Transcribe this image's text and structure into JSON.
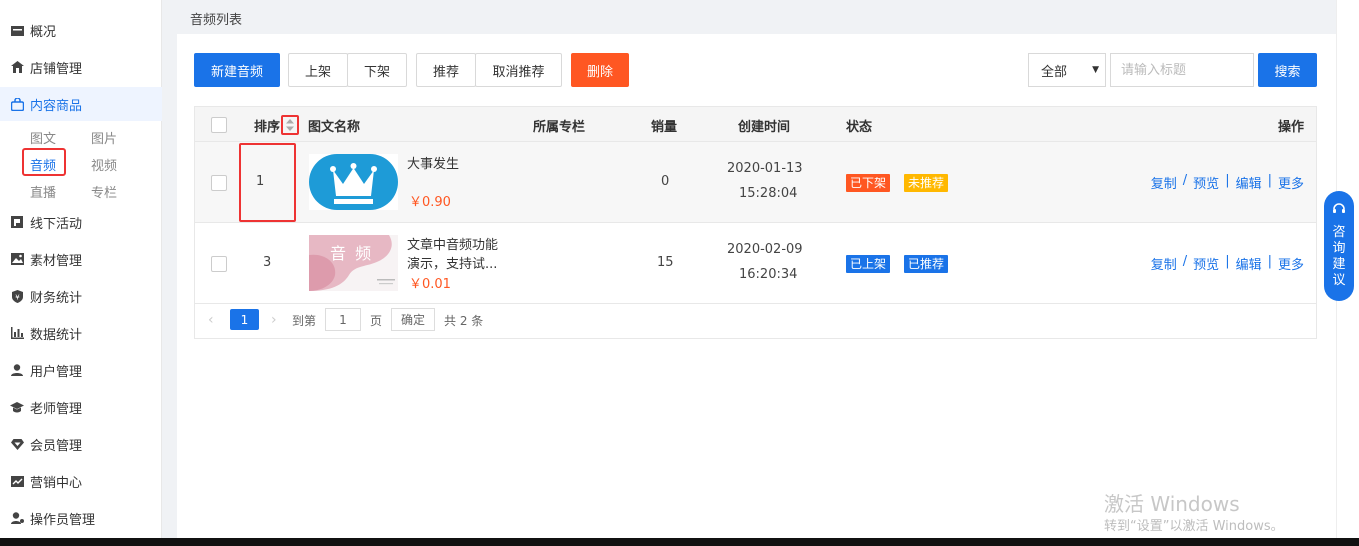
{
  "sidebar": {
    "items": [
      {
        "label": "概况",
        "icon": "folder-icon"
      },
      {
        "label": "店铺管理",
        "icon": "home-icon"
      },
      {
        "label": "内容商品",
        "icon": "bag-icon"
      },
      {
        "label": "线下活动",
        "icon": "flag-icon"
      },
      {
        "label": "素材管理",
        "icon": "image-icon"
      },
      {
        "label": "财务统计",
        "icon": "shield-icon"
      },
      {
        "label": "数据统计",
        "icon": "bar-chart-icon"
      },
      {
        "label": "用户管理",
        "icon": "user-icon"
      },
      {
        "label": "老师管理",
        "icon": "graduation-cap-icon"
      },
      {
        "label": "会员管理",
        "icon": "diamond-icon"
      },
      {
        "label": "营销中心",
        "icon": "trend-icon"
      },
      {
        "label": "操作员管理",
        "icon": "operator-icon"
      }
    ],
    "sub_items": [
      "图文",
      "图片",
      "音频",
      "视频",
      "直播",
      "专栏"
    ]
  },
  "breadcrumb": "音频列表",
  "toolbar": {
    "new_label": "新建音频",
    "shelve_label": "上架",
    "unshelve_label": "下架",
    "recommend_label": "推荐",
    "unrecommend_label": "取消推荐",
    "delete_label": "删除",
    "filter_value": "全部",
    "search_placeholder": "请输入标题",
    "search_label": "搜索"
  },
  "table": {
    "headers": {
      "sort": "排序",
      "name": "图文名称",
      "column": "所属专栏",
      "sales": "销量",
      "created": "创建时间",
      "status": "状态",
      "actions": "操作"
    },
    "rows": [
      {
        "sort": "1",
        "title": "大事发生",
        "price": "￥0.90",
        "sales": "0",
        "date": "2020-01-13",
        "time": "15:28:04",
        "status1": "已下架",
        "status2": "未推荐"
      },
      {
        "sort": "3",
        "title": "文章中音频功能演示，支持试...",
        "price": "￥0.01",
        "sales": "15",
        "date": "2020-02-09",
        "time": "16:20:34",
        "status1": "已上架",
        "status2": "已推荐",
        "thumb_text": "音 频"
      }
    ],
    "actions": {
      "copy": "复制",
      "preview": "预览",
      "edit": "编辑",
      "more": "更多"
    }
  },
  "pager": {
    "current": "1",
    "goto": "到第",
    "page_input": "1",
    "page_unit": "页",
    "confirm": "确定",
    "total": "共 2 条"
  },
  "consult": [
    "咨",
    "询",
    "建",
    "议"
  ],
  "watermark": {
    "line1": "激活 Windows",
    "line2": "转到“设置”以激活 Windows。"
  },
  "colors": {
    "primary": "#1a73e8",
    "danger": "#ff5722",
    "warning": "#ffb800"
  }
}
